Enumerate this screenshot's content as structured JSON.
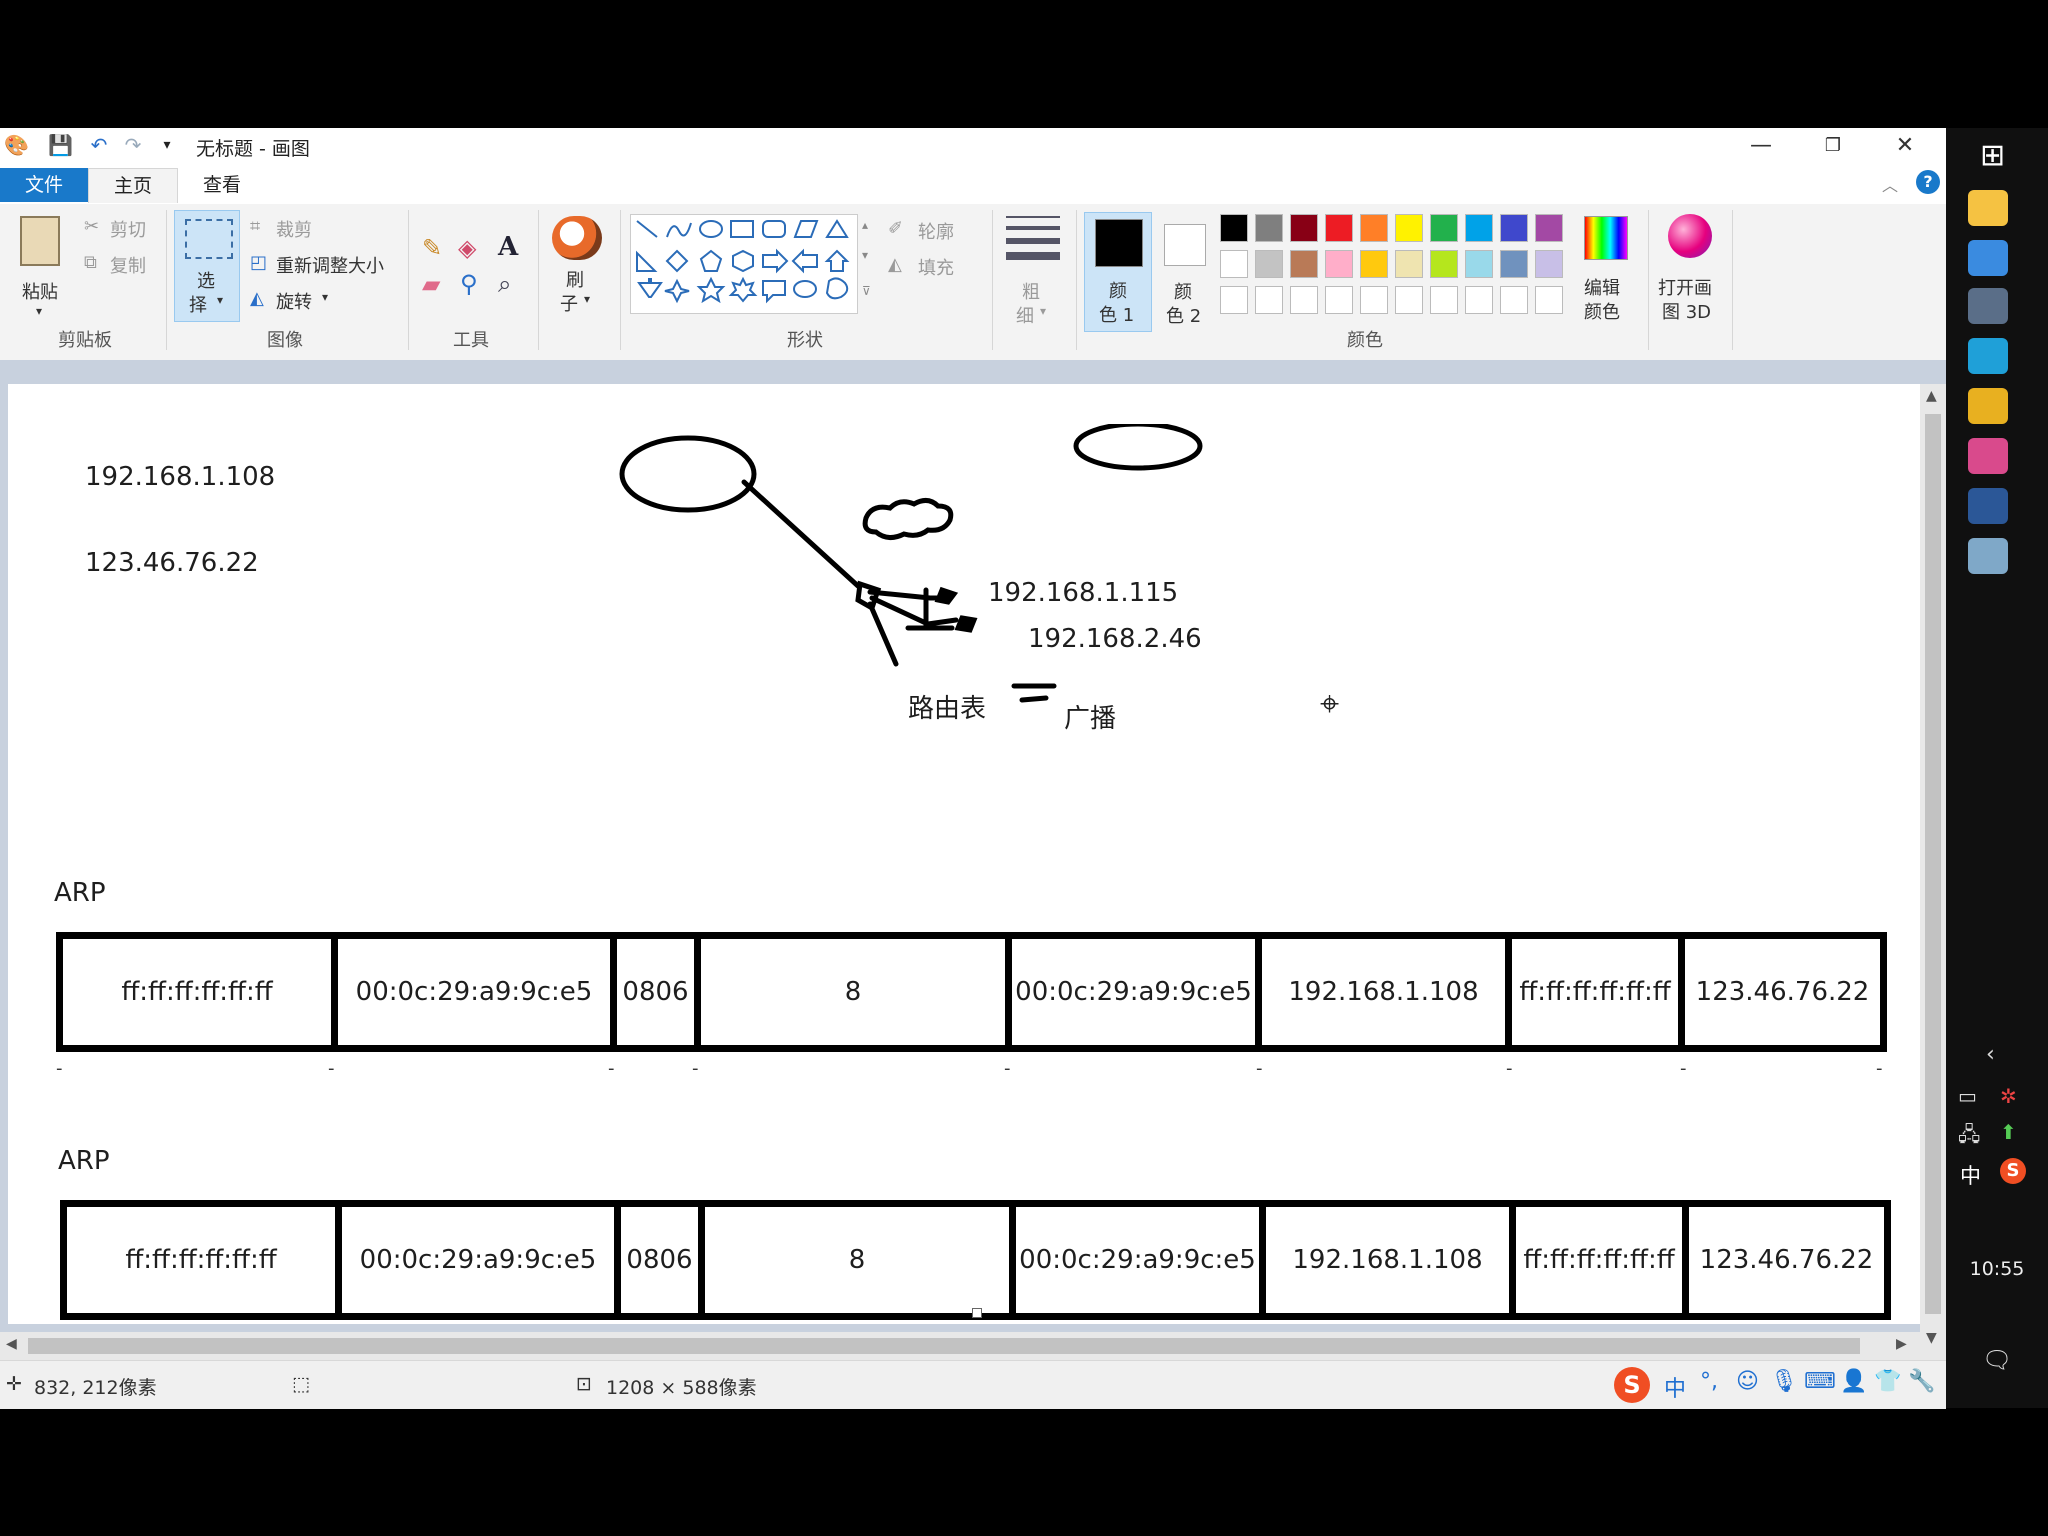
{
  "window": {
    "title": "无标题 - 画图",
    "controls": {
      "minimize": "—",
      "restore": "❐",
      "close": "✕"
    }
  },
  "tabs": {
    "file": "文件",
    "home": "主页",
    "view": "查看"
  },
  "ribbon": {
    "clipboard": {
      "paste": "粘贴",
      "cut": "剪切",
      "copy": "复制",
      "label": "剪贴板"
    },
    "image": {
      "select_1": "选",
      "select_2": "择",
      "crop": "裁剪",
      "resize": "重新调整大小",
      "rotate": "旋转",
      "label": "图像"
    },
    "tools": {
      "label": "工具"
    },
    "brushes": {
      "line1": "刷",
      "line2": "子"
    },
    "shapes": {
      "outline": "轮廓",
      "fill": "填充",
      "label": "形状"
    },
    "size": {
      "line1": "粗",
      "line2": "细"
    },
    "color1": {
      "line1": "颜",
      "line2": "色 1"
    },
    "color2": {
      "line1": "颜",
      "line2": "色 2"
    },
    "edit_colors": {
      "line1": "编辑",
      "line2": "颜色"
    },
    "paint3d": {
      "line1": "打开画",
      "line2": "图 3D"
    },
    "colors_label": "颜色",
    "palette_row1": [
      "#000000",
      "#7f7f7f",
      "#880015",
      "#ed1c24",
      "#ff7f27",
      "#fff200",
      "#22b14c",
      "#00a2e8",
      "#3f48cc",
      "#a349a4"
    ],
    "palette_row2": [
      "#ffffff",
      "#c3c3c3",
      "#b97a57",
      "#ffaec9",
      "#ffc90e",
      "#efe4b0",
      "#b5e61d",
      "#99d9ea",
      "#7092be",
      "#c8bfe7"
    ]
  },
  "canvas": {
    "ip_top": "192.168.1.108",
    "ip_second": "123.46.76.22",
    "node_ip_1": "192.168.1.115",
    "node_ip_2": "192.168.2.46",
    "routing_table": "路由表",
    "broadcast": "广播",
    "arp_label_1": "ARP",
    "arp_label_2": "ARP",
    "arp_row_1": [
      "ff:ff:ff:ff:ff:ff",
      "00:0c:29:a9:9c:e5",
      "0806",
      "8",
      "00:0c:29:a9:9c:e5",
      "192.168.1.108",
      "ff:ff:ff:ff:ff:ff",
      "123.46.76.22"
    ],
    "arp_row_2": [
      "ff:ff:ff:ff:ff:ff",
      "00:0c:29:a9:9c:e5",
      "0806",
      "8",
      "00:0c:29:a9:9c:e5",
      "192.168.1.108",
      "ff:ff:ff:ff:ff:ff",
      "123.46.76.22"
    ]
  },
  "status": {
    "cursor_pos": "832, 212像素",
    "canvas_size": "1208 × 588像素"
  },
  "taskbar": {
    "ime": "中",
    "clock": "10:55"
  },
  "ime_toolbar": {
    "mode": "中"
  }
}
